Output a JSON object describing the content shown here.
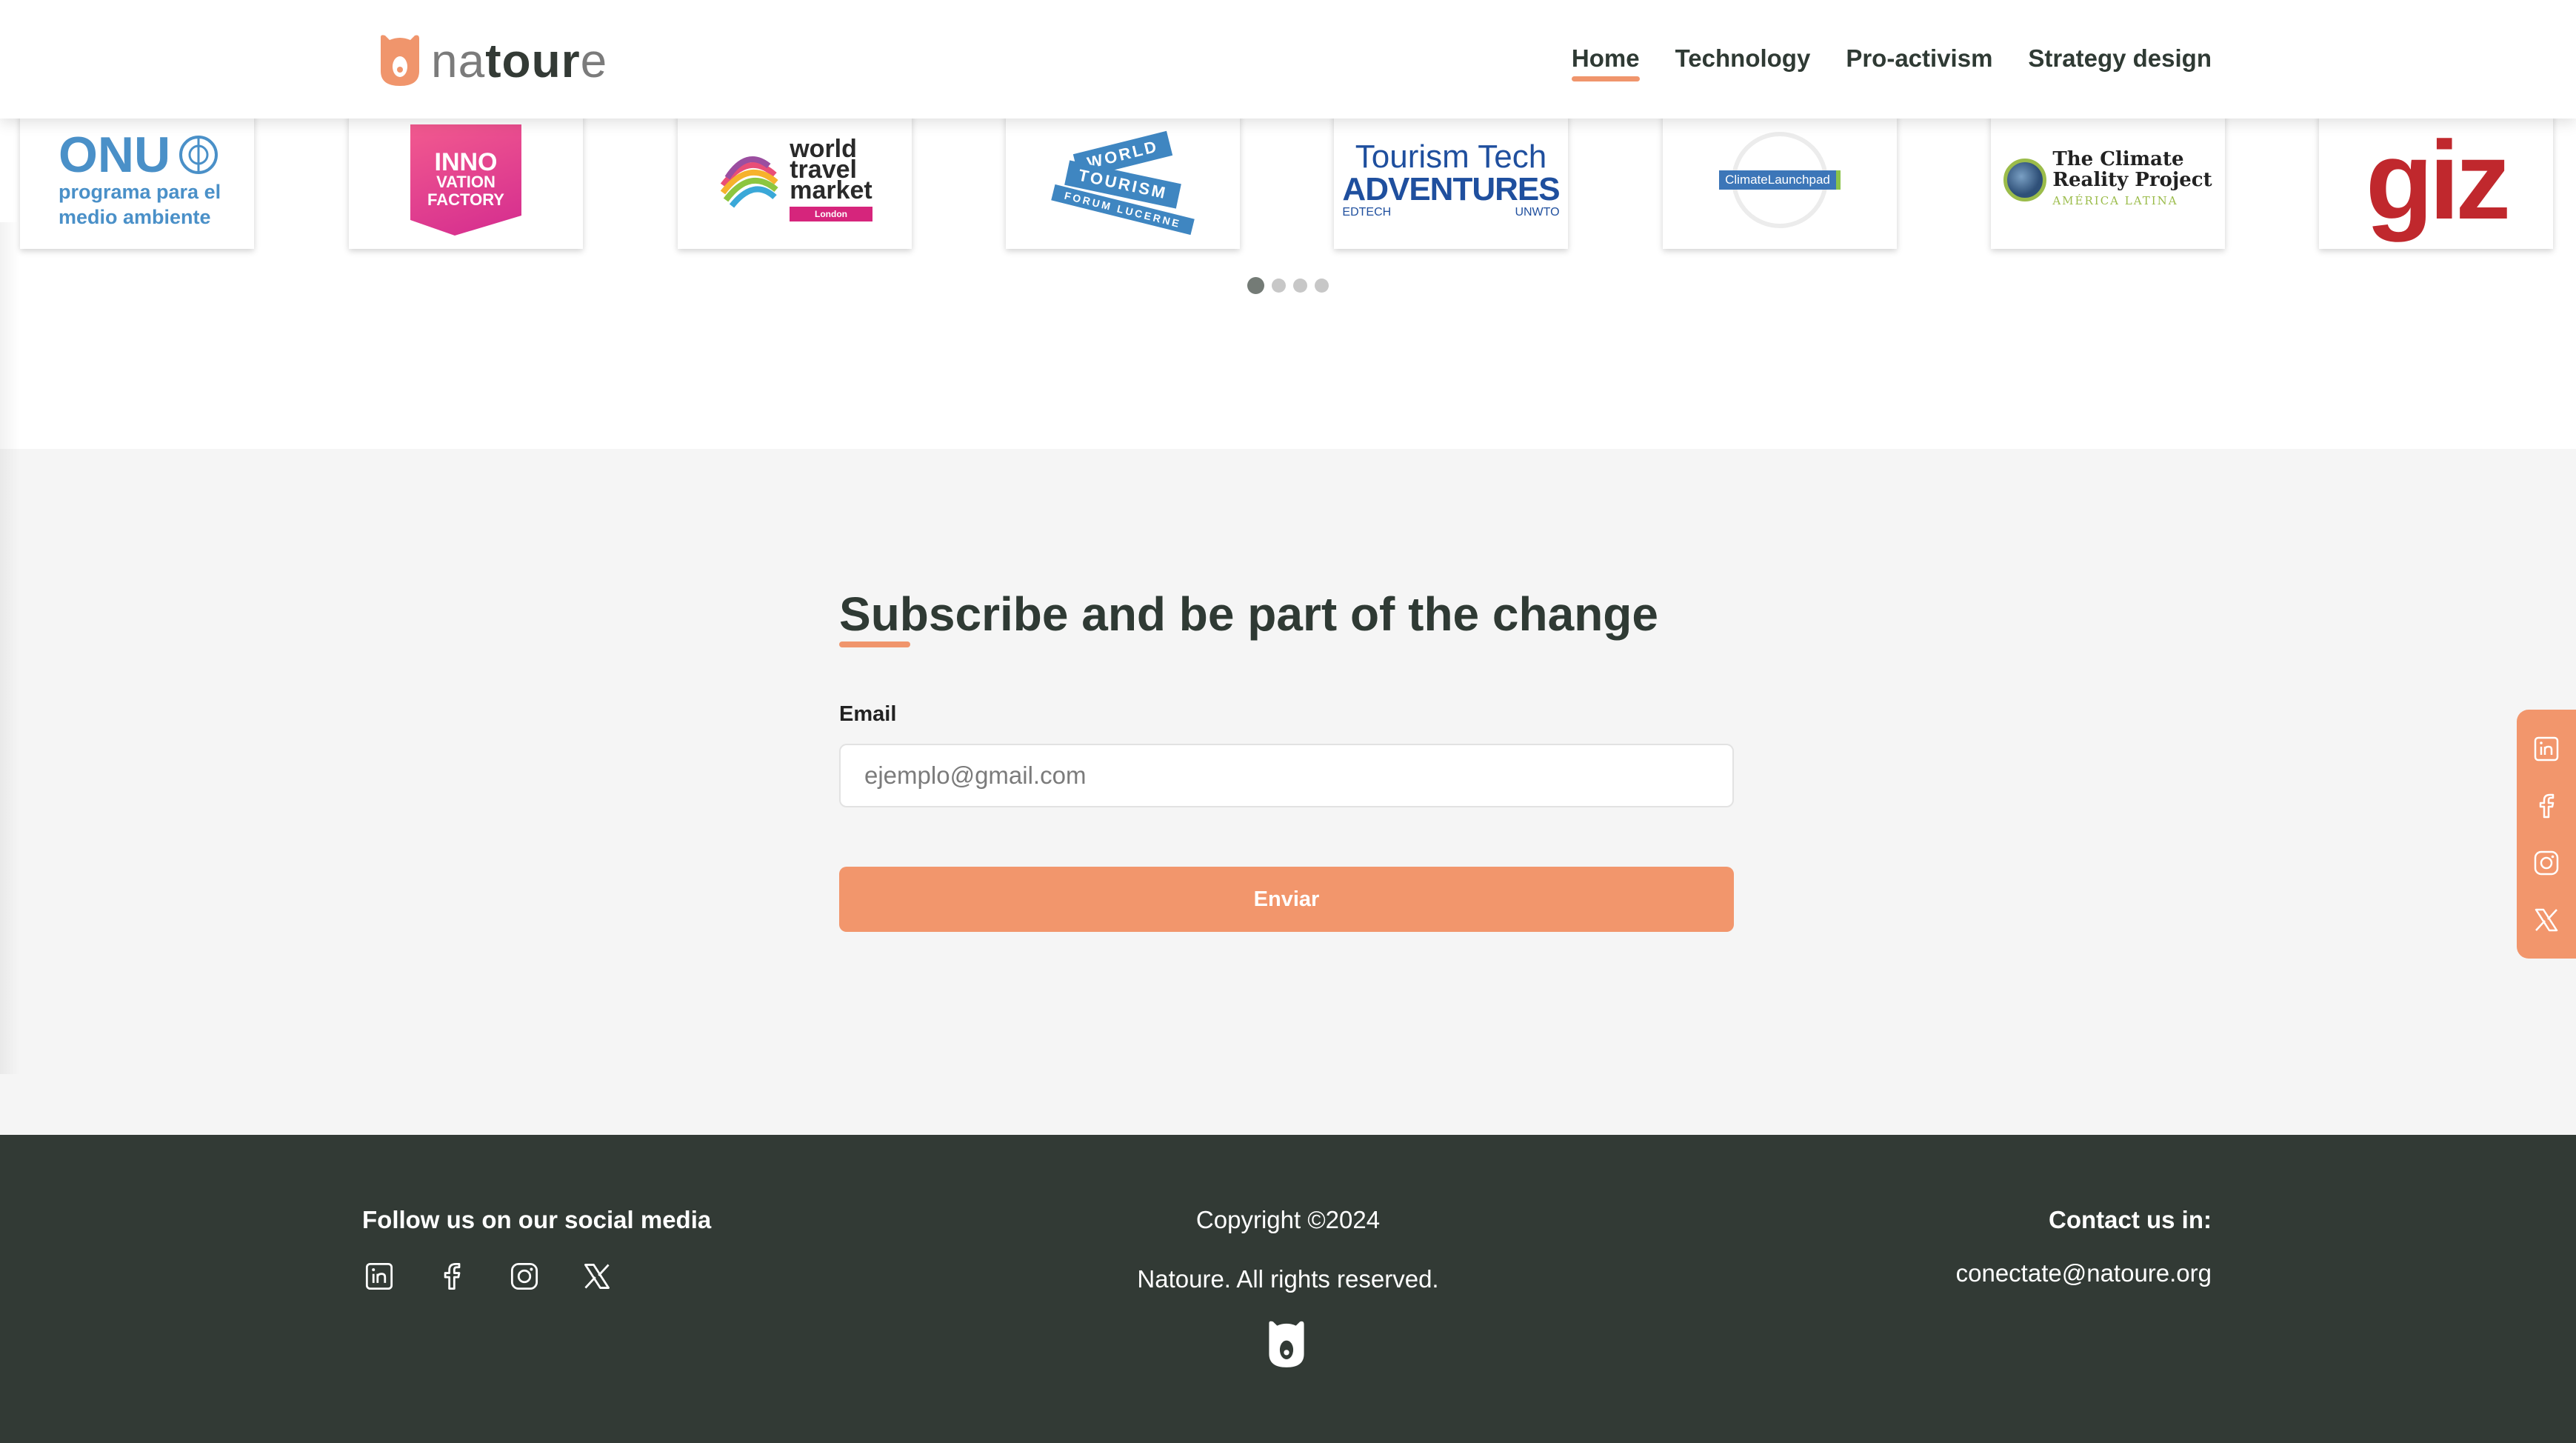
{
  "header": {
    "logo": {
      "part1": "na",
      "part2": "tour",
      "part3": "e"
    },
    "nav": [
      {
        "label": "Home",
        "active": true
      },
      {
        "label": "Technology",
        "active": false
      },
      {
        "label": "Pro-activism",
        "active": false
      },
      {
        "label": "Strategy design",
        "active": false
      }
    ]
  },
  "partners": {
    "logos": [
      {
        "name": "onu",
        "text_big": "ONU",
        "text_line1": "programa para el",
        "text_line2": "medio ambiente"
      },
      {
        "name": "innovation-factory",
        "line1": "INNO",
        "line2": "VATION",
        "line3": "FACTORY"
      },
      {
        "name": "world-travel-market",
        "line1": "world",
        "line2": "travel",
        "line3": "market",
        "tag": "London"
      },
      {
        "name": "world-tourism-forum",
        "line1": "WORLD",
        "line2": "TOURISM",
        "line3": "FORUM",
        "line4": "LUCERNE"
      },
      {
        "name": "tourism-tech-adventures",
        "line1": "Tourism Tech",
        "line2": "ADVENTURES",
        "line3a": "EDTECH",
        "line3b": "UNWTO"
      },
      {
        "name": "climate-launchpad",
        "label": "ClimateLaunchpad"
      },
      {
        "name": "climate-reality-project",
        "line1": "The Climate",
        "line2": "Reality Project",
        "line3": "AMÉRICA LATINA"
      },
      {
        "name": "giz",
        "text": "giz"
      }
    ],
    "carousel": {
      "total_pages": 4,
      "current_page": 1
    }
  },
  "subscribe": {
    "title": "Subscribe and be part of the change",
    "email_label": "Email",
    "email_placeholder": "ejemplo@gmail.com",
    "email_value": "",
    "submit_label": "Enviar"
  },
  "side_social": [
    "linkedin-icon",
    "facebook-icon",
    "instagram-icon",
    "x-icon"
  ],
  "footer": {
    "follow_title": "Follow us on our social media",
    "social": [
      "linkedin-icon",
      "facebook-icon",
      "instagram-icon",
      "x-icon"
    ],
    "copyright": "Copyright ©2024",
    "rights": "Natoure. All rights reserved.",
    "contact_title": "Contact us in:",
    "contact_email": "conectate@natoure.org"
  },
  "colors": {
    "accent": "#f0956c",
    "dark": "#323a35",
    "light_bg": "#f5f5f5"
  }
}
